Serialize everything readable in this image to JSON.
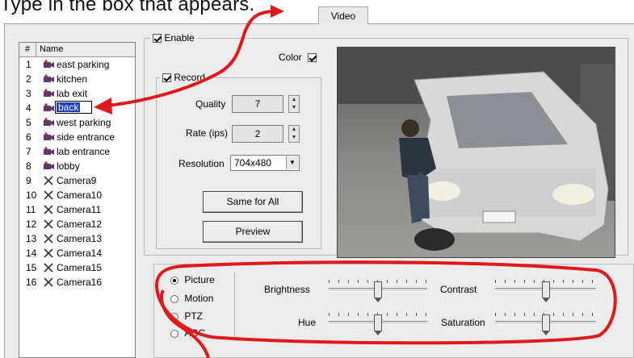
{
  "header": {
    "text": "Type in the box that appears."
  },
  "tab": {
    "label": "Video"
  },
  "camera_list": {
    "columns": [
      "#",
      "Name"
    ],
    "rows": [
      {
        "num": "1",
        "name": "east parking",
        "icon": "camera-icon"
      },
      {
        "num": "2",
        "name": "kitchen",
        "icon": "camera-icon"
      },
      {
        "num": "3",
        "name": "lab exit",
        "icon": "camera-icon"
      },
      {
        "num": "4",
        "name": "back",
        "icon": "camera-icon",
        "editing": true
      },
      {
        "num": "5",
        "name": "west parking",
        "icon": "camera-icon"
      },
      {
        "num": "6",
        "name": "side entrance",
        "icon": "camera-icon"
      },
      {
        "num": "7",
        "name": "lab entrance",
        "icon": "camera-icon"
      },
      {
        "num": "8",
        "name": "lobby",
        "icon": "camera-icon"
      },
      {
        "num": "9",
        "name": "Camera9",
        "icon": "x-icon"
      },
      {
        "num": "10",
        "name": "Camera10",
        "icon": "x-icon"
      },
      {
        "num": "11",
        "name": "Camera11",
        "icon": "x-icon"
      },
      {
        "num": "12",
        "name": "Camera12",
        "icon": "x-icon"
      },
      {
        "num": "13",
        "name": "Camera13",
        "icon": "x-icon"
      },
      {
        "num": "14",
        "name": "Camera14",
        "icon": "x-icon"
      },
      {
        "num": "15",
        "name": "Camera15",
        "icon": "x-icon"
      },
      {
        "num": "16",
        "name": "Camera16",
        "icon": "x-icon"
      }
    ]
  },
  "settings": {
    "enable_label": "Enable",
    "enable_checked": true,
    "color_label": "Color",
    "color_checked": true,
    "record_label": "Record",
    "record_checked": true,
    "quality_label": "Quality",
    "quality_value": "7",
    "rate_label": "Rate (ips)",
    "rate_value": "2",
    "resolution_label": "Resolution",
    "resolution_value": "704x480",
    "same_for_all_label": "Same for All",
    "preview_label": "Preview"
  },
  "adjust": {
    "modes": [
      {
        "label": "Picture",
        "selected": true
      },
      {
        "label": "Motion",
        "selected": false
      },
      {
        "label": "PTZ",
        "selected": false
      },
      {
        "label": "AGC",
        "selected": false
      }
    ],
    "sliders": {
      "brightness": {
        "label": "Brightness",
        "level": 0.5
      },
      "contrast": {
        "label": "Contrast",
        "level": 0.5
      },
      "hue": {
        "label": "Hue",
        "level": 0.5
      },
      "saturation": {
        "label": "Saturation",
        "level": 0.5
      }
    }
  },
  "colors": {
    "annotation_red": "#e01a1a",
    "selection_blue": "#1f3fbf"
  }
}
